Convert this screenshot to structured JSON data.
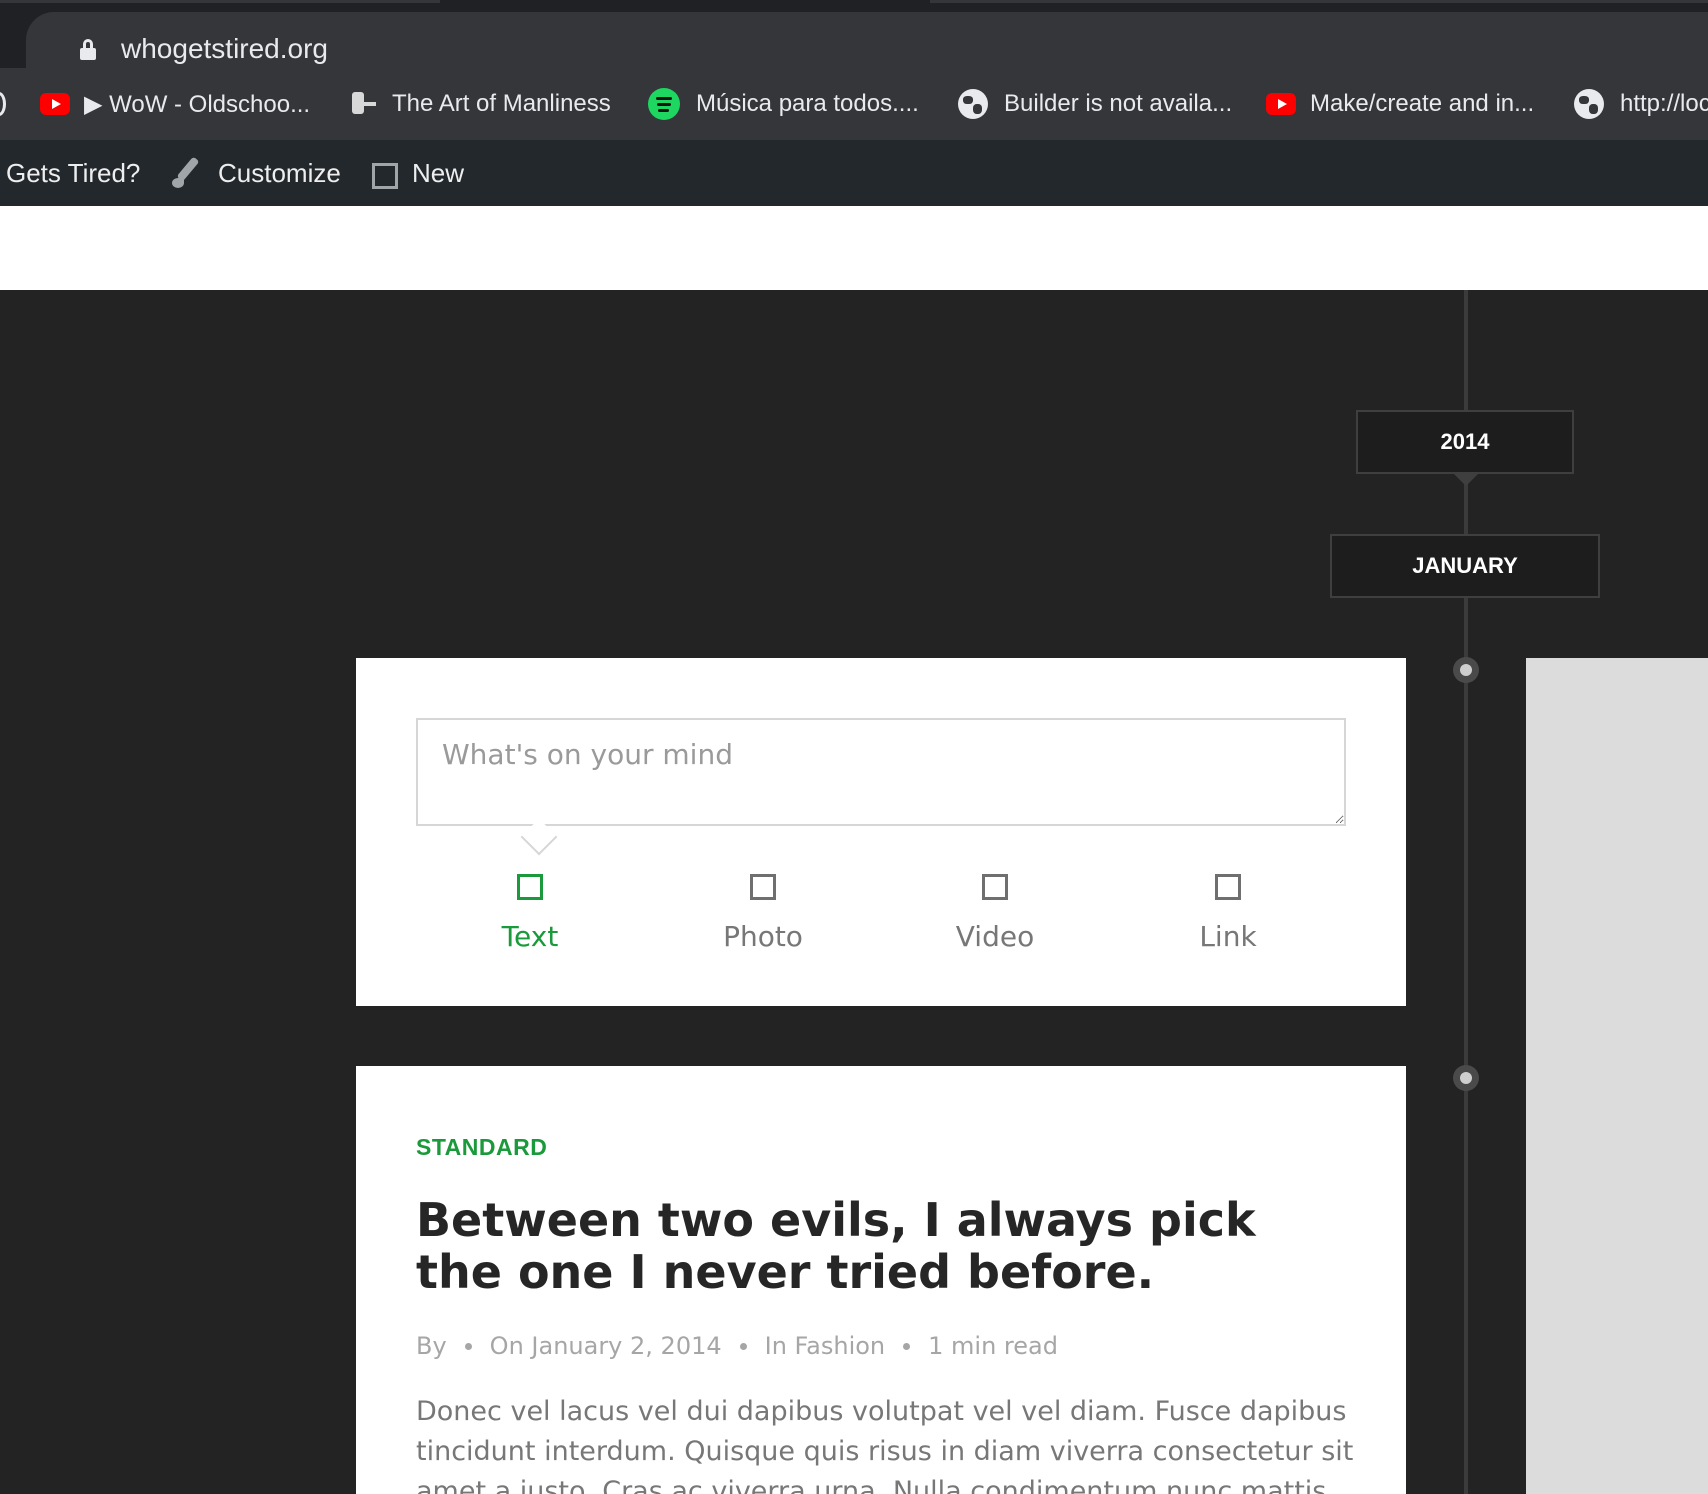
{
  "browser": {
    "url": "whogetstired.org",
    "bookmarks": [
      {
        "icon": "youtube-icon",
        "label": "▶ WoW - Oldschoo..."
      },
      {
        "icon": "art-of-manliness-icon",
        "label": "The Art of Manliness"
      },
      {
        "icon": "spotify-icon",
        "label": "Música para todos...."
      },
      {
        "icon": "globe-icon",
        "label": "Builder is not availa..."
      },
      {
        "icon": "youtube-icon",
        "label": "Make/create and in..."
      },
      {
        "icon": "globe-icon",
        "label": "http://loc"
      }
    ]
  },
  "adminbar": {
    "site": "Gets Tired?",
    "customize": "Customize",
    "new": "New"
  },
  "timeline": {
    "year": "2014",
    "month": "JANUARY"
  },
  "composer": {
    "placeholder": "What's on your mind",
    "types": [
      {
        "label": "Text",
        "active": true
      },
      {
        "label": "Photo",
        "active": false
      },
      {
        "label": "Video",
        "active": false
      },
      {
        "label": "Link",
        "active": false
      }
    ]
  },
  "post": {
    "category": "STANDARD",
    "title": "Between two evils, I always pick the one I never tried before.",
    "meta_by": "By",
    "meta_date": "On January 2, 2014",
    "meta_category": "In Fashion",
    "meta_read": "1 min read",
    "excerpt": "Donec vel lacus vel dui dapibus volutpat vel vel diam. Fusce dapibus tincidunt interdum. Quisque quis risus in diam viverra consectetur sit amet a justo. Cras ac viverra urna. Nulla condimentum nunc mattis fe-"
  },
  "colors": {
    "accent": "#1a9a3a",
    "page_bg": "#232323",
    "adminbar_bg": "#23282d"
  }
}
